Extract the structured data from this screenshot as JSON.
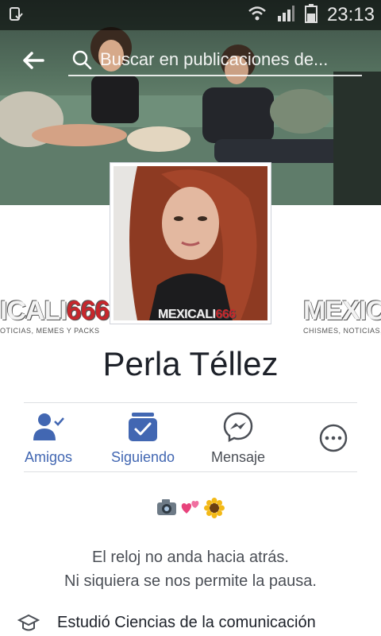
{
  "status_bar": {
    "time": "23:13"
  },
  "search": {
    "placeholder": "Buscar en publicaciones de..."
  },
  "profile": {
    "name": "Perla Téllez",
    "watermark": {
      "brand_text": "MEXICALI",
      "brand_num": "666",
      "brand_sub": "CHISMES, NOTICIAS, MEMES Y PACKS"
    }
  },
  "side_watermarks": {
    "left_text": "ICALI",
    "left_num": "666",
    "left_sub": "OTICIAS, MEMES Y PACKS",
    "right_text": "MEXICALI",
    "right_sub": "CHISMES, NOTICIAS, ME"
  },
  "actions": [
    {
      "label": "Amigos",
      "icon": "friends-check-icon"
    },
    {
      "label": "Siguiendo",
      "icon": "following-feed-icon"
    },
    {
      "label": "Mensaje",
      "icon": "messenger-icon"
    },
    {
      "label": "",
      "icon": "more-options-icon"
    }
  ],
  "bio": {
    "emojis": [
      "camera",
      "two-hearts",
      "sunflower"
    ],
    "line1": "El reloj no anda hacia atrás.",
    "line2": "Ni siquiera se nos permite la pausa."
  },
  "education": {
    "text": "Estudió Ciencias de la comunicación"
  },
  "colors": {
    "accent": "#4267b2",
    "text": "#1d2129",
    "secondary": "#4b4f56",
    "divider": "#dddfe2"
  }
}
